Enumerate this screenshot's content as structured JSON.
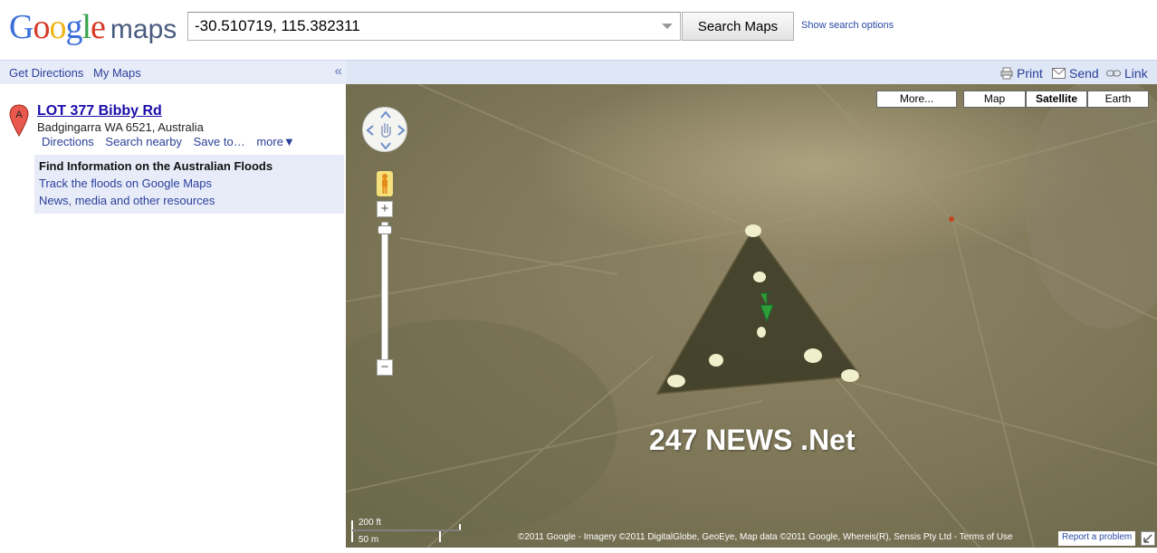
{
  "header": {
    "logo_letters": [
      {
        "ch": "G",
        "color": "#3b6fd8"
      },
      {
        "ch": "o",
        "color": "#d73a2a"
      },
      {
        "ch": "o",
        "color": "#eeb417"
      },
      {
        "ch": "g",
        "color": "#3b6fd8"
      },
      {
        "ch": "l",
        "color": "#37a34a"
      },
      {
        "ch": "e",
        "color": "#d73a2a"
      }
    ],
    "logo_suffix": "maps",
    "search_value": "-30.510719, 115.382311",
    "search_button": "Search Maps",
    "search_options": "Show search options"
  },
  "left_bar": {
    "get_directions": "Get Directions",
    "my_maps": "My Maps",
    "collapse": "«"
  },
  "result": {
    "marker_letter": "A",
    "title": "LOT 377 Bibby Rd",
    "address": "Badgingarra WA 6521, Australia",
    "links": [
      "Directions",
      "Search nearby",
      "Save to…",
      "more▼"
    ]
  },
  "info": {
    "heading": "Find Information on the Australian Floods",
    "link1": "Track the floods on Google Maps",
    "link2": "News, media and other resources"
  },
  "right_bar": {
    "print": "Print",
    "send": "Send",
    "link": "Link"
  },
  "map": {
    "types": {
      "more": "More...",
      "map": "Map",
      "satellite": "Satellite",
      "earth": "Earth"
    },
    "selected_type": "Satellite",
    "watermark": "247 NEWS .Net",
    "scale_ft": "200 ft",
    "scale_m": "50 m",
    "copyright": "©2011 Google - Imagery ©2011 DigitalGlobe, GeoEye, Map data ©2011 Google, Whereis(R), Sensis Pty Ltd - Terms of Use",
    "report": "Report a problem"
  }
}
